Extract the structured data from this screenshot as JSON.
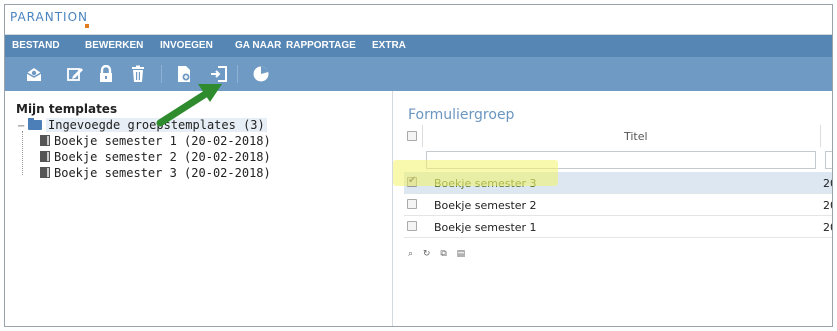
{
  "app": {
    "brand": "PARANTION",
    "brand_accent": "#e07b20"
  },
  "menu": [
    {
      "label": "BESTAND"
    },
    {
      "label": "BEWERKEN"
    },
    {
      "label": "INVOEGEN"
    },
    {
      "label": "GA NAAR"
    },
    {
      "label": "RAPPORTAGE"
    },
    {
      "label": "EXTRA"
    }
  ],
  "toolbar": {
    "icons": [
      "envelope-open-icon",
      "edit-icon",
      "lock-icon",
      "trash-icon",
      "add-document-icon",
      "import-door-icon",
      "pie-chart-icon"
    ]
  },
  "tree": {
    "title": "Mijn templates",
    "group": {
      "label": "Ingevoegde groepstemplates (3)"
    },
    "items": [
      {
        "label": "Boekje semester 1 (20-02-2018)"
      },
      {
        "label": "Boekje semester 2 (20-02-2018)"
      },
      {
        "label": "Boekje semester 3 (20-02-2018)"
      }
    ]
  },
  "panel": {
    "title": "Formuliergroep",
    "column_title": "Titel",
    "rows": [
      {
        "name": "Boekje semester 3",
        "date": "20-",
        "checked": true,
        "selected": true
      },
      {
        "name": "Boekje semester 2",
        "date": "20-",
        "checked": false,
        "selected": false
      },
      {
        "name": "Boekje semester 1",
        "date": "20-",
        "checked": false,
        "selected": false
      }
    ],
    "pager_icons": [
      "search-icon",
      "refresh-icon",
      "copy-icon",
      "table-icon"
    ]
  },
  "colors": {
    "menubar": "#5686b4",
    "toolbar": "#6f9ac3",
    "panel_title": "#6a96c0",
    "highlight": "#f4f46a",
    "arrow": "#2e8b2e"
  }
}
